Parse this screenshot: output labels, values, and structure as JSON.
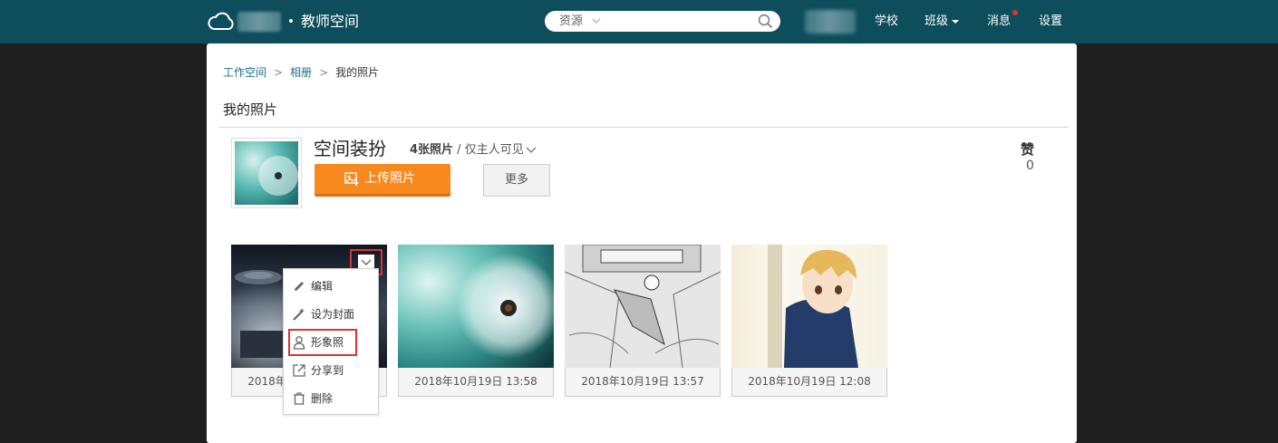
{
  "header": {
    "site_title": "教师空间",
    "search_category": "资源",
    "search_value": "",
    "nav": {
      "school": "学校",
      "class": "班级",
      "messages": "消息",
      "settings": "设置"
    },
    "colors": {
      "bar": "#0e4d5b",
      "notification_dot": "#e0322d"
    }
  },
  "breadcrumb": {
    "items": [
      "工作空间",
      "相册",
      "我的照片"
    ],
    "separator": ">"
  },
  "page_title": "我的照片",
  "album": {
    "name": "空间装扮",
    "photo_count": "4张照片",
    "meta_sep": " / ",
    "visibility": "仅主人可见",
    "upload_label": "上传照片",
    "more_label": "更多",
    "likes_label": "赞",
    "likes_count": "0",
    "accent": "#f8891f"
  },
  "photos": [
    {
      "date": "2018年10月19日 14:00",
      "subject": "sci-fi city night"
    },
    {
      "date": "2018年10月19日 13:58",
      "subject": "dandelion"
    },
    {
      "date": "2018年10月19日 13:57",
      "subject": "manga sketch"
    },
    {
      "date": "2018年10月19日 12:08",
      "subject": "anime boy"
    }
  ],
  "photo_menu": {
    "edit": "编辑",
    "set_cover": "设为封面",
    "set_avatar": "形象照",
    "share": "分享到",
    "delete": "删除"
  }
}
